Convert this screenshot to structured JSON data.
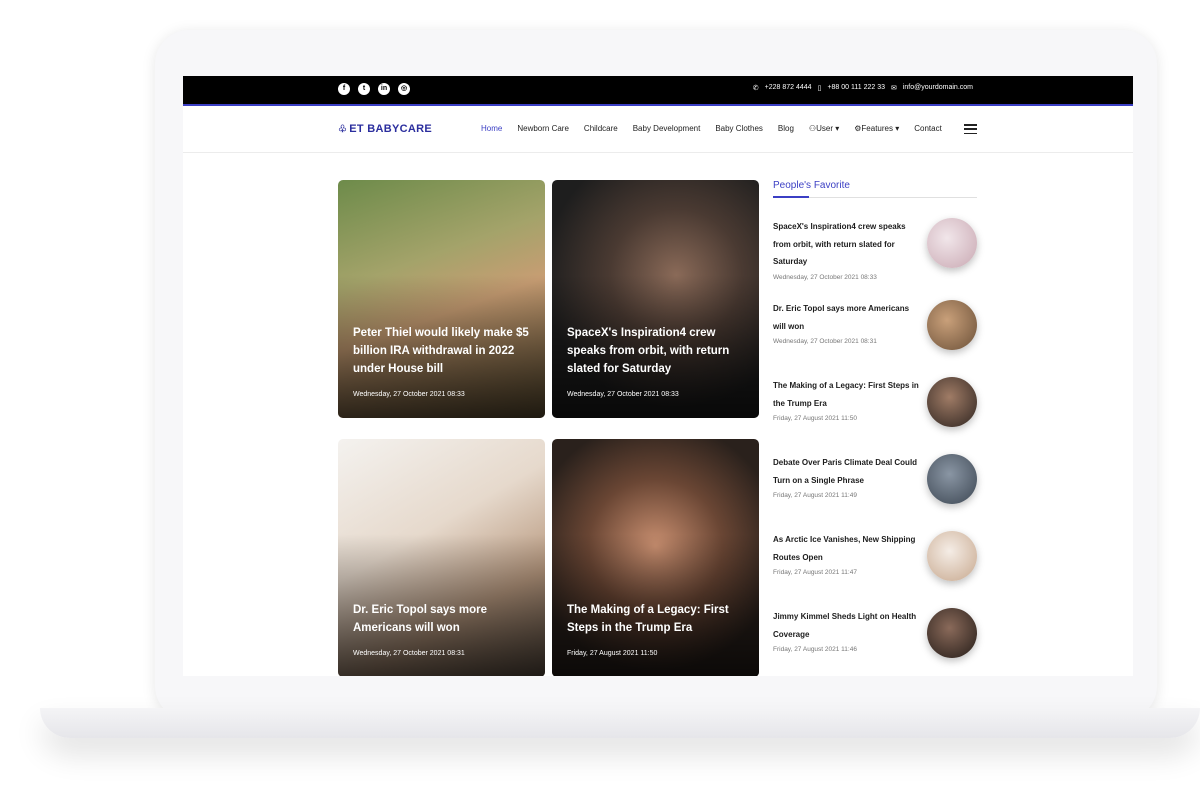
{
  "topbar": {
    "socials": [
      {
        "icon": "facebook-icon",
        "glyph": "f"
      },
      {
        "icon": "twitter-icon",
        "glyph": "t"
      },
      {
        "icon": "linkedin-icon",
        "glyph": "in"
      },
      {
        "icon": "instagram-icon",
        "glyph": "◎"
      }
    ],
    "phone1": "+228 872 4444",
    "phone2": "+88 00 111 222 33",
    "email": "info@yourdomain.com"
  },
  "nav": {
    "logo": "ET BABYCARE",
    "menu": [
      {
        "label": "Home",
        "active": true
      },
      {
        "label": "Newborn Care"
      },
      {
        "label": "Childcare"
      },
      {
        "label": "Baby Development"
      },
      {
        "label": "Baby Clothes"
      },
      {
        "label": "Blog"
      },
      {
        "label": "User ▾",
        "icon": "user-icon"
      },
      {
        "label": "Features ▾",
        "icon": "features-icon"
      },
      {
        "label": "Contact"
      }
    ]
  },
  "cards": [
    {
      "title": "Peter Thiel would likely make $5 billion IRA withdrawal in 2022 under House bill",
      "date": "Wednesday, 27 October 2021 08:33"
    },
    {
      "title": "SpaceX's Inspiration4 crew speaks from orbit, with return slated for Saturday",
      "date": "Wednesday, 27 October 2021 08:33"
    },
    {
      "title": "Dr. Eric Topol says more Americans will won",
      "date": "Wednesday, 27 October 2021 08:31"
    },
    {
      "title": "The Making of a Legacy: First Steps in the Trump Era",
      "date": "Friday, 27 August 2021 11:50"
    }
  ],
  "sidebar": {
    "title": "People's Favorite",
    "items": [
      {
        "title": "SpaceX's Inspiration4 crew speaks from orbit, with return slated for Saturday",
        "date": "Wednesday, 27 October 2021 08:33",
        "color": "#d9c9cf"
      },
      {
        "title": "Dr. Eric Topol says more Americans will won",
        "date": "Wednesday, 27 October 2021 08:31",
        "color": "#8a6a4a"
      },
      {
        "title": "The Making of a Legacy: First Steps in the Trump Era",
        "date": "Friday, 27 August 2021 11:50",
        "color": "#4a3a32"
      },
      {
        "title": "Debate Over Paris Climate Deal Could Turn on a Single Phrase",
        "date": "Friday, 27 August 2021 11:49",
        "color": "#5e6a78"
      },
      {
        "title": "As Arctic Ice Vanishes, New Shipping Routes Open",
        "date": "Friday, 27 August 2021 11:47",
        "color": "#e8dcd2"
      },
      {
        "title": "Jimmy Kimmel Sheds Light on Health Coverage",
        "date": "Friday, 27 August 2021 11:46",
        "color": "#3a2f2a"
      }
    ]
  },
  "colors": {
    "accent": "#3b3fc4",
    "topbar": "#000000"
  }
}
